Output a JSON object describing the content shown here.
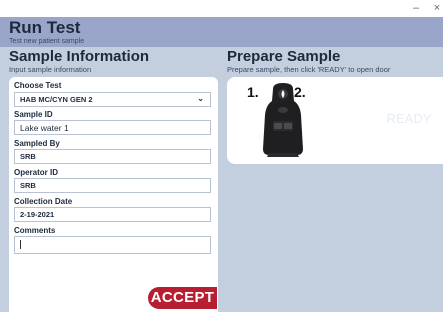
{
  "window": {
    "minimize_glyph": "–",
    "close_glyph": "×"
  },
  "header": {
    "title": "Run Test",
    "subtitle": "Test new patient sample"
  },
  "sample_info": {
    "title": "Sample Information",
    "subtitle": "Input sample information",
    "fields": {
      "choose_test": {
        "label": "Choose Test",
        "value": "HAB MC/CYN GEN 2"
      },
      "sample_id": {
        "label": "Sample ID",
        "value": "Lake water 1"
      },
      "sampled_by": {
        "label": "Sampled By",
        "value": "SRB"
      },
      "operator_id": {
        "label": "Operator ID",
        "value": "SRB"
      },
      "collection_date": {
        "label": "Collection Date",
        "value": "2-19-2021"
      },
      "comments": {
        "label": "Comments",
        "value": ""
      }
    },
    "accept_label": "ACCEPT"
  },
  "prepare": {
    "title": "Prepare Sample",
    "subtitle": "Prepare sample, then click 'READY' to open door",
    "step1": "1.",
    "step2": "2.",
    "ready_label": "READY"
  },
  "colors": {
    "background": "#c3cfdf",
    "header": "#9aa6c9",
    "accent": "#b61f32"
  }
}
